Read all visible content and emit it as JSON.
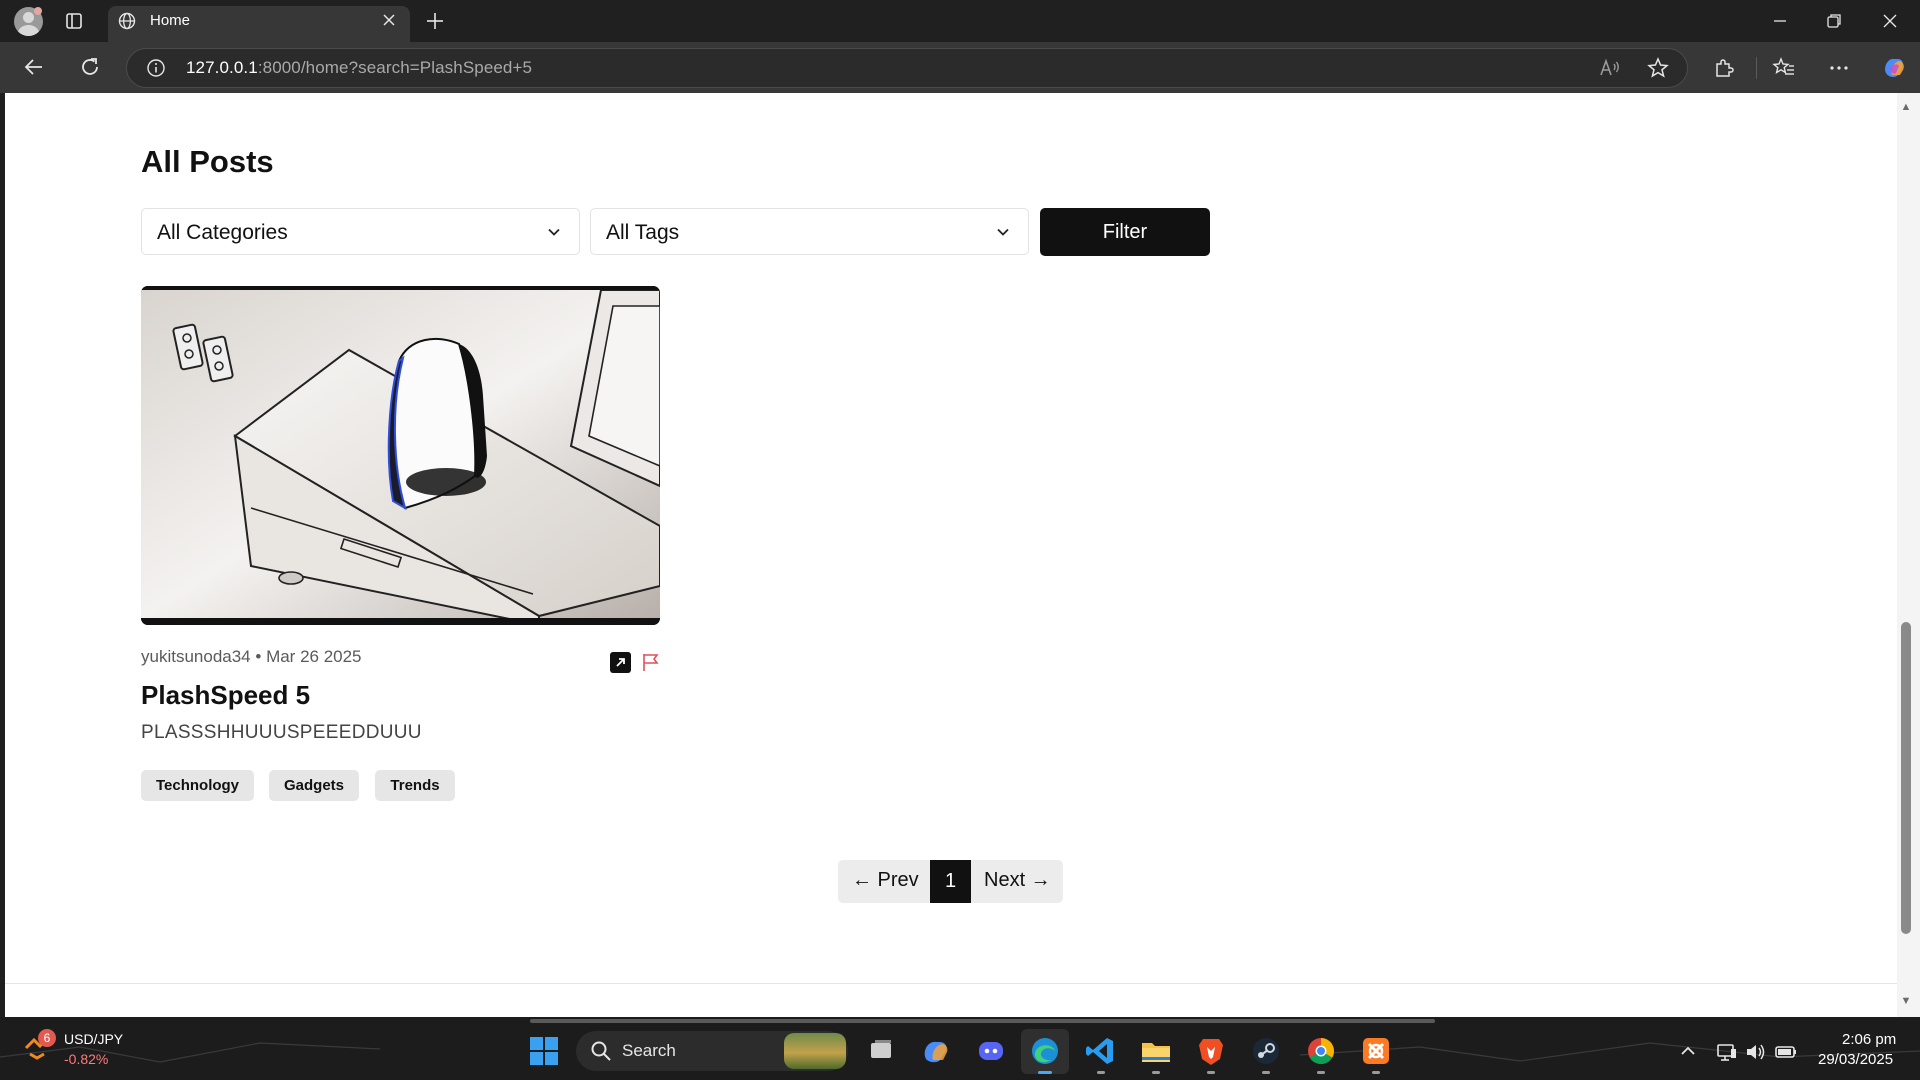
{
  "browser": {
    "tab_title": "Home",
    "url_host": "127.0.0.1",
    "url_rest": ":8000/home?search=PlashSpeed+5"
  },
  "page": {
    "title": "All Posts",
    "filters": {
      "category_selected": "All Categories",
      "tag_selected": "All Tags",
      "button_label": "Filter"
    },
    "posts": [
      {
        "author": "yukitsunoda34",
        "separator": "•",
        "date": "Mar 26 2025",
        "title": "PlashSpeed 5",
        "excerpt": "PLASSSHHUUUSPEEEDDUUU",
        "tags": [
          "Technology",
          "Gadgets",
          "Trends"
        ]
      }
    ],
    "pagination": {
      "prev_label": "← Prev",
      "current_page": "1",
      "next_label": "Next →"
    }
  },
  "taskbar": {
    "ticker_name": "USD/JPY",
    "ticker_change": "-0.82%",
    "weather_badge": "6",
    "search_label": "Search",
    "time": "2:06 pm",
    "date": "29/03/2025"
  },
  "colors": {
    "accent": "#111111",
    "flag": "#e0505a",
    "ticker_negative": "#ff7a7a"
  }
}
